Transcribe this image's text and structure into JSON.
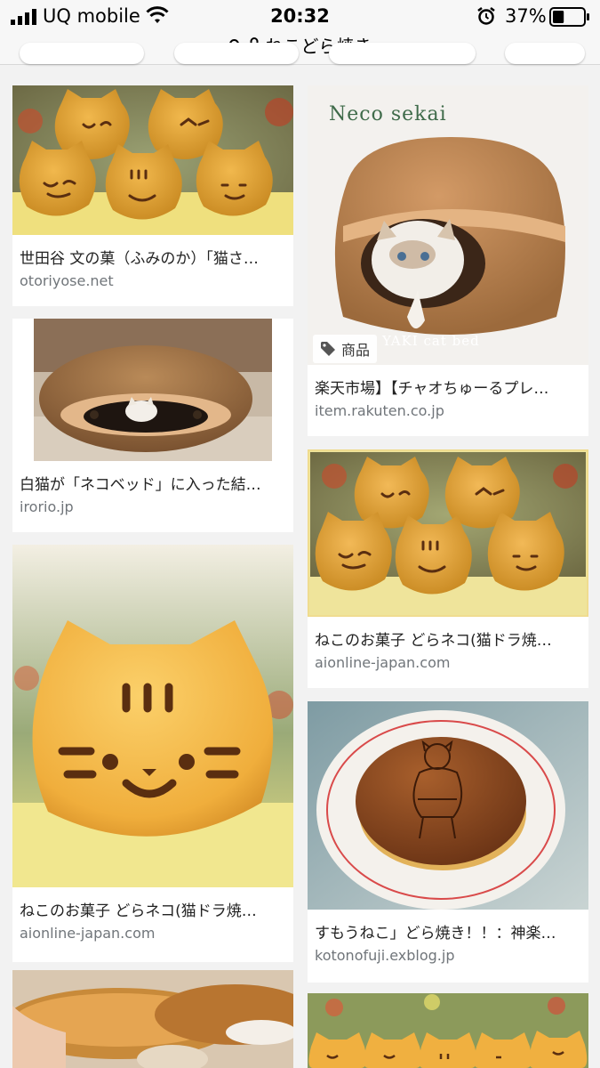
{
  "status": {
    "carrier": "UQ mobile",
    "time": "20:32",
    "battery": "37%",
    "battery_level": 0.37
  },
  "url_bar": {
    "query": "ねこどら焼き"
  },
  "results": [
    {
      "title": "世田谷 文の菓（ふみのか）「猫さ…",
      "domain": "otoriyose.net"
    },
    {
      "title": "白猫が「ネコベッド」に入った結…",
      "domain": "irorio.jp"
    },
    {
      "title": "ねこのお菓子 どらネコ(猫ドラ焼…",
      "domain": "aionline-japan.com"
    },
    {
      "title": "楽天市場】【チャオちゅーるプレ…",
      "domain": "item.rakuten.co.jp",
      "badge": "商品",
      "image_caption": "Neco sekai",
      "image_caption2": "YAKI cat bed"
    },
    {
      "title": "ねこのお菓子 どらネコ(猫ドラ焼…",
      "domain": "aionline-japan.com"
    },
    {
      "title": "すもうねこ」どら焼き！！：神楽…",
      "domain": "kotonofuji.exblog.jp"
    }
  ],
  "icons": {
    "search": "search-icon",
    "lock": "lock-icon",
    "tag": "tag-icon"
  }
}
